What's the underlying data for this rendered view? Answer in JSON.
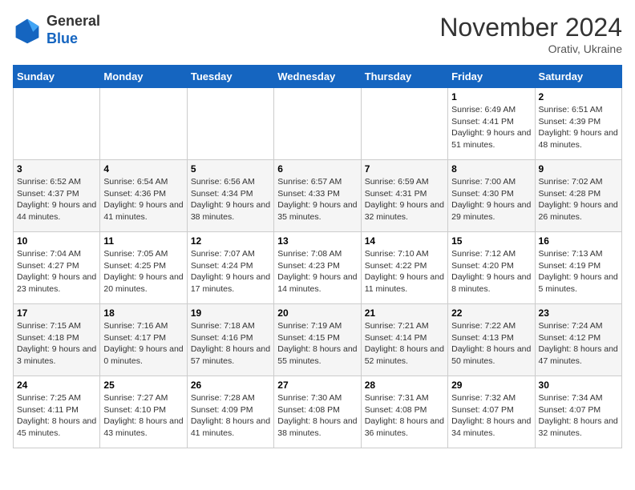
{
  "logo": {
    "general": "General",
    "blue": "Blue"
  },
  "title": "November 2024",
  "location": "Orativ, Ukraine",
  "days_of_week": [
    "Sunday",
    "Monday",
    "Tuesday",
    "Wednesday",
    "Thursday",
    "Friday",
    "Saturday"
  ],
  "weeks": [
    [
      {
        "day": "",
        "info": ""
      },
      {
        "day": "",
        "info": ""
      },
      {
        "day": "",
        "info": ""
      },
      {
        "day": "",
        "info": ""
      },
      {
        "day": "",
        "info": ""
      },
      {
        "day": "1",
        "info": "Sunrise: 6:49 AM\nSunset: 4:41 PM\nDaylight: 9 hours and 51 minutes."
      },
      {
        "day": "2",
        "info": "Sunrise: 6:51 AM\nSunset: 4:39 PM\nDaylight: 9 hours and 48 minutes."
      }
    ],
    [
      {
        "day": "3",
        "info": "Sunrise: 6:52 AM\nSunset: 4:37 PM\nDaylight: 9 hours and 44 minutes."
      },
      {
        "day": "4",
        "info": "Sunrise: 6:54 AM\nSunset: 4:36 PM\nDaylight: 9 hours and 41 minutes."
      },
      {
        "day": "5",
        "info": "Sunrise: 6:56 AM\nSunset: 4:34 PM\nDaylight: 9 hours and 38 minutes."
      },
      {
        "day": "6",
        "info": "Sunrise: 6:57 AM\nSunset: 4:33 PM\nDaylight: 9 hours and 35 minutes."
      },
      {
        "day": "7",
        "info": "Sunrise: 6:59 AM\nSunset: 4:31 PM\nDaylight: 9 hours and 32 minutes."
      },
      {
        "day": "8",
        "info": "Sunrise: 7:00 AM\nSunset: 4:30 PM\nDaylight: 9 hours and 29 minutes."
      },
      {
        "day": "9",
        "info": "Sunrise: 7:02 AM\nSunset: 4:28 PM\nDaylight: 9 hours and 26 minutes."
      }
    ],
    [
      {
        "day": "10",
        "info": "Sunrise: 7:04 AM\nSunset: 4:27 PM\nDaylight: 9 hours and 23 minutes."
      },
      {
        "day": "11",
        "info": "Sunrise: 7:05 AM\nSunset: 4:25 PM\nDaylight: 9 hours and 20 minutes."
      },
      {
        "day": "12",
        "info": "Sunrise: 7:07 AM\nSunset: 4:24 PM\nDaylight: 9 hours and 17 minutes."
      },
      {
        "day": "13",
        "info": "Sunrise: 7:08 AM\nSunset: 4:23 PM\nDaylight: 9 hours and 14 minutes."
      },
      {
        "day": "14",
        "info": "Sunrise: 7:10 AM\nSunset: 4:22 PM\nDaylight: 9 hours and 11 minutes."
      },
      {
        "day": "15",
        "info": "Sunrise: 7:12 AM\nSunset: 4:20 PM\nDaylight: 9 hours and 8 minutes."
      },
      {
        "day": "16",
        "info": "Sunrise: 7:13 AM\nSunset: 4:19 PM\nDaylight: 9 hours and 5 minutes."
      }
    ],
    [
      {
        "day": "17",
        "info": "Sunrise: 7:15 AM\nSunset: 4:18 PM\nDaylight: 9 hours and 3 minutes."
      },
      {
        "day": "18",
        "info": "Sunrise: 7:16 AM\nSunset: 4:17 PM\nDaylight: 9 hours and 0 minutes."
      },
      {
        "day": "19",
        "info": "Sunrise: 7:18 AM\nSunset: 4:16 PM\nDaylight: 8 hours and 57 minutes."
      },
      {
        "day": "20",
        "info": "Sunrise: 7:19 AM\nSunset: 4:15 PM\nDaylight: 8 hours and 55 minutes."
      },
      {
        "day": "21",
        "info": "Sunrise: 7:21 AM\nSunset: 4:14 PM\nDaylight: 8 hours and 52 minutes."
      },
      {
        "day": "22",
        "info": "Sunrise: 7:22 AM\nSunset: 4:13 PM\nDaylight: 8 hours and 50 minutes."
      },
      {
        "day": "23",
        "info": "Sunrise: 7:24 AM\nSunset: 4:12 PM\nDaylight: 8 hours and 47 minutes."
      }
    ],
    [
      {
        "day": "24",
        "info": "Sunrise: 7:25 AM\nSunset: 4:11 PM\nDaylight: 8 hours and 45 minutes."
      },
      {
        "day": "25",
        "info": "Sunrise: 7:27 AM\nSunset: 4:10 PM\nDaylight: 8 hours and 43 minutes."
      },
      {
        "day": "26",
        "info": "Sunrise: 7:28 AM\nSunset: 4:09 PM\nDaylight: 8 hours and 41 minutes."
      },
      {
        "day": "27",
        "info": "Sunrise: 7:30 AM\nSunset: 4:08 PM\nDaylight: 8 hours and 38 minutes."
      },
      {
        "day": "28",
        "info": "Sunrise: 7:31 AM\nSunset: 4:08 PM\nDaylight: 8 hours and 36 minutes."
      },
      {
        "day": "29",
        "info": "Sunrise: 7:32 AM\nSunset: 4:07 PM\nDaylight: 8 hours and 34 minutes."
      },
      {
        "day": "30",
        "info": "Sunrise: 7:34 AM\nSunset: 4:07 PM\nDaylight: 8 hours and 32 minutes."
      }
    ]
  ]
}
